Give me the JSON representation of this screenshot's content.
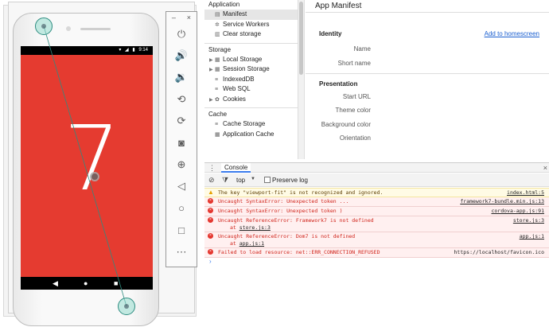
{
  "emulator": {
    "status_time": "9:14",
    "app_glyph": "7",
    "toolbar": {
      "minimize": "–",
      "close": "×",
      "buttons": [
        "power-icon",
        "volume-up-icon",
        "volume-down-icon",
        "rotate-left-icon",
        "rotate-right-icon",
        "camera-icon",
        "zoom-icon",
        "back-icon",
        "home-icon",
        "overview-icon",
        "more-icon"
      ]
    },
    "colors": {
      "screen": "#e53b30",
      "touch": "#96dccd"
    }
  },
  "app_nav": {
    "application_heading": "Application",
    "application_items": [
      {
        "label": "Manifest",
        "icon": "file-icon",
        "selected": true
      },
      {
        "label": "Service Workers",
        "icon": "gear-icon"
      },
      {
        "label": "Clear storage",
        "icon": "trash-icon"
      }
    ],
    "storage_heading": "Storage",
    "storage_items": [
      {
        "label": "Local Storage",
        "icon": "grid-icon",
        "expandable": true
      },
      {
        "label": "Session Storage",
        "icon": "grid-icon",
        "expandable": true
      },
      {
        "label": "IndexedDB",
        "icon": "database-icon"
      },
      {
        "label": "Web SQL",
        "icon": "database-icon"
      },
      {
        "label": "Cookies",
        "icon": "cookie-icon",
        "expandable": true
      }
    ],
    "cache_heading": "Cache",
    "cache_items": [
      {
        "label": "Cache Storage",
        "icon": "database-icon"
      },
      {
        "label": "Application Cache",
        "icon": "grid-icon"
      }
    ]
  },
  "manifest": {
    "title": "App Manifest",
    "identity_heading": "Identity",
    "add_to_homescreen": "Add to homescreen",
    "name_label": "Name",
    "short_name_label": "Short name",
    "presentation_heading": "Presentation",
    "start_url_label": "Start URL",
    "theme_color_label": "Theme color",
    "background_color_label": "Background color",
    "orientation_label": "Orientation"
  },
  "drawer": {
    "tab_console": "Console",
    "context": "top",
    "preserve_log": "Preserve log"
  },
  "console_messages": [
    {
      "level": "warning",
      "text": "The key \"viewport-fit\" is not recognized and ignored.",
      "source": "index.html:5"
    },
    {
      "level": "error",
      "text": "Uncaught SyntaxError: Unexpected token ...",
      "source": "framework7-bundle.min.js:13"
    },
    {
      "level": "error",
      "text": "Uncaught SyntaxError: Unexpected token )",
      "source": "cordova-app.js:91"
    },
    {
      "level": "error",
      "text": "Uncaught ReferenceError: Framework7 is not defined",
      "source": "store.js:3",
      "trace_prefix": "at ",
      "trace_link": "store.js:3"
    },
    {
      "level": "error",
      "text": "Uncaught ReferenceError: Dom7 is not defined",
      "source": "app.js:1",
      "trace_prefix": "at ",
      "trace_link": "app.js:1"
    },
    {
      "level": "error",
      "text": "Failed to load resource: net::ERR_CONNECTION_REFUSED",
      "source": "https://localhost/favicon.ico"
    }
  ],
  "console_prompt": "›"
}
